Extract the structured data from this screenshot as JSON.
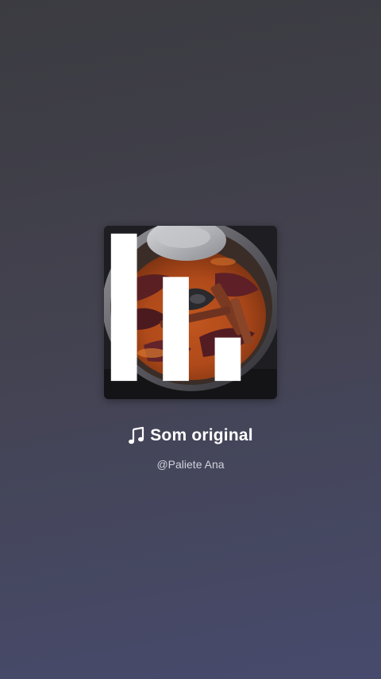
{
  "sound": {
    "title": "Som original",
    "author": "@Paliete Ana",
    "icon": "music-note-icon"
  },
  "cover": {
    "alt": "pot with cinnamon sticks and dried chilies simmering",
    "badge_icon": "audio-bars-icon"
  },
  "colors": {
    "background_top": "#3b3b41",
    "background_bottom": "#474a6c",
    "title_text": "#ffffff",
    "author_text": "#d2d3dc"
  }
}
